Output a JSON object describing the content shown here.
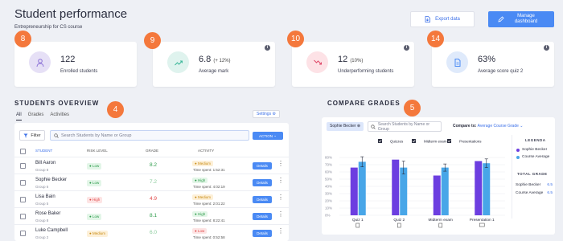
{
  "header": {
    "title": "Student performance",
    "subtitle": "Entrepreneurship for CS course",
    "export_label": "Export data",
    "manage_label": "Manage dashboard"
  },
  "badges": {
    "enrolled": "8",
    "average_mark": "9",
    "underperforming": "10",
    "average_score": "14",
    "overview": "4",
    "compare": "5"
  },
  "stats": [
    {
      "value": "122",
      "extra": "",
      "label": "Enrolled students",
      "icon": "users-icon",
      "icon_bg": "#e6e0f6",
      "icon_color": "#8a6fd6"
    },
    {
      "value": "6.8",
      "extra": "(+ 12%)",
      "label": "Average mark",
      "icon": "trend-up-icon",
      "icon_bg": "#dff3ee",
      "icon_color": "#3cb89a"
    },
    {
      "value": "12",
      "extra": "(10%)",
      "label": "Underperforming students",
      "icon": "trend-down-icon",
      "icon_bg": "#fde2e6",
      "icon_color": "#e04868"
    },
    {
      "value": "63%",
      "extra": "",
      "label": "Average score quiz 2",
      "icon": "document-icon",
      "icon_bg": "#dfeafb",
      "icon_color": "#4a8af4"
    }
  ],
  "overview": {
    "title": "STUDENTS OVERVIEW",
    "tabs": [
      "All",
      "Grades",
      "Activities"
    ],
    "settings_label": "Settings",
    "filter_label": "Filter",
    "search_placeholder": "Search Students by Name or Group",
    "action_label": "ACTION",
    "columns": {
      "student": "STUDENT",
      "risk": "RISK LEVEL",
      "grade": "GRADE",
      "activity": "ACTIVITY"
    },
    "rows": [
      {
        "name": "Bill Aaron",
        "group": "Group 8",
        "risk": "Low",
        "risk_class": "low",
        "grade": "8.2",
        "grade_color": "#2a9a48",
        "activity": "Medium",
        "activity_class": "medium",
        "time": "Time spent: 1:52:31",
        "details": "Details"
      },
      {
        "name": "Sophie Becker",
        "group": "Group 6",
        "risk": "Low",
        "risk_class": "low",
        "grade": "7.2",
        "grade_color": "#8acb9c",
        "activity": "High",
        "activity_class": "high",
        "time": "Time spent: 4:02:19",
        "details": "Details"
      },
      {
        "name": "Lisa Bain",
        "group": "Group 5",
        "risk": "High",
        "risk_class": "high",
        "grade": "4.9",
        "grade_color": "#e04848",
        "activity": "Medium",
        "activity_class": "medium",
        "time": "Time spent: 2:01:22",
        "details": "Details"
      },
      {
        "name": "Rose Baker",
        "group": "Group 8",
        "risk": "Low",
        "risk_class": "low",
        "grade": "8.1",
        "grade_color": "#2a9a48",
        "activity": "High",
        "activity_class": "high",
        "time": "Time spent: 8:22:41",
        "details": "Details"
      },
      {
        "name": "Luke Campbell",
        "group": "Group 2",
        "risk": "Medium",
        "risk_class": "medium",
        "grade": "6.0",
        "grade_color": "#8acb9c",
        "activity": "Low",
        "activity_class": "low",
        "time": "Time spent: 0:52:58",
        "details": "Details"
      }
    ]
  },
  "compare": {
    "title": "COMPARE GRADES",
    "chip_label": "Sophie Becker",
    "search_placeholder": "Search Students by Name or Group",
    "compare_to_label": "Compare to:",
    "compare_to_value": "Average Course Grade",
    "filters": [
      "Quizzes",
      "Midterm exam",
      "Presentations"
    ],
    "legend_title": "LEGENDA",
    "legend": [
      {
        "name": "Sophie Becker",
        "color": "#6c3ee0"
      },
      {
        "name": "Course Average",
        "color": "#48a6e8"
      }
    ],
    "total_grade_title": "TOTAL GRADE",
    "total_grades": [
      {
        "name": "Sophie Becker",
        "value": "6.5"
      },
      {
        "name": "Course Average",
        "value": "6.5"
      }
    ]
  },
  "chart_data": {
    "type": "bar",
    "categories": [
      "Quiz 1",
      "Quiz 2",
      "Midterm exam",
      "Presentation 1"
    ],
    "series": [
      {
        "name": "Sophie Becker",
        "values": [
          66,
          77,
          55,
          75
        ],
        "color": "#6c3ee0"
      },
      {
        "name": "Course Average",
        "values": [
          74,
          66,
          66,
          72
        ],
        "color": "#48a6e8",
        "error": [
          7,
          9,
          5,
          6
        ]
      }
    ],
    "yticks": [
      "0%",
      "10%",
      "20%",
      "30%",
      "40%",
      "50%",
      "60%",
      "70%",
      "80%"
    ],
    "ylim": [
      0,
      80
    ],
    "category_icons": [
      "document-icon",
      "document-icon",
      "exam-icon",
      "monitor-icon"
    ]
  }
}
